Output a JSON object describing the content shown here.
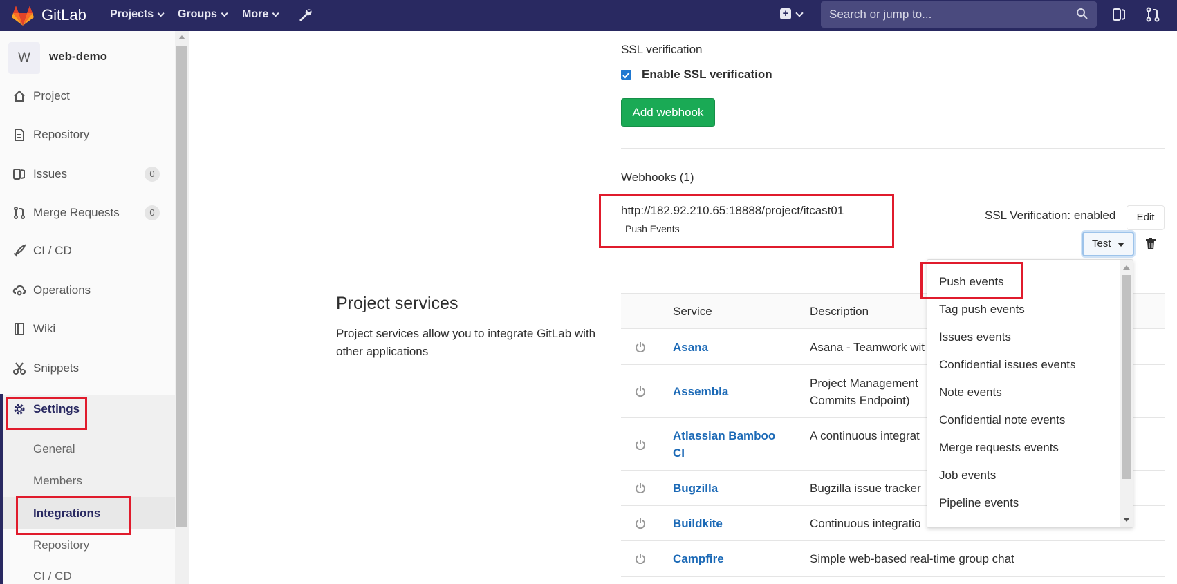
{
  "topnav": {
    "brand": "GitLab",
    "links": [
      "Projects",
      "Groups",
      "More"
    ],
    "search_placeholder": "Search or jump to..."
  },
  "sidebar": {
    "project_avatar": "W",
    "project_name": "web-demo",
    "items": [
      {
        "label": "Project",
        "icon": "home-icon"
      },
      {
        "label": "Repository",
        "icon": "file-icon"
      },
      {
        "label": "Issues",
        "icon": "issues-icon",
        "count": "0"
      },
      {
        "label": "Merge Requests",
        "icon": "merge-request-icon",
        "count": "0"
      },
      {
        "label": "CI / CD",
        "icon": "rocket-icon"
      },
      {
        "label": "Operations",
        "icon": "cloud-gear-icon"
      },
      {
        "label": "Wiki",
        "icon": "book-icon"
      },
      {
        "label": "Snippets",
        "icon": "scissors-icon"
      },
      {
        "label": "Settings",
        "icon": "gear-icon"
      }
    ],
    "settings_sub": [
      "General",
      "Members",
      "Integrations",
      "Repository",
      "CI / CD"
    ]
  },
  "ssl": {
    "heading": "SSL verification",
    "checkbox_label": "Enable SSL verification",
    "checked": true
  },
  "add_webhook_label": "Add webhook",
  "webhooks": {
    "heading": "Webhooks (1)",
    "url": "http://182.92.210.65:18888/project/itcast01",
    "badge": "Push Events",
    "ssl_status": "SSL Verification: enabled",
    "edit_label": "Edit",
    "test_label": "Test"
  },
  "project_services": {
    "title": "Project services",
    "description": "Project services allow you to integrate GitLab with other applications",
    "headers": [
      "Service",
      "Description"
    ],
    "rows": [
      {
        "service": "Asana",
        "description": "Asana - Teamwork wit"
      },
      {
        "service": "Assembla",
        "description": "Project Management Commits Endpoint)"
      },
      {
        "service": "Atlassian Bamboo CI",
        "description": "A continuous integrat"
      },
      {
        "service": "Bugzilla",
        "description": "Bugzilla issue tracker"
      },
      {
        "service": "Buildkite",
        "description": "Continuous integratio"
      },
      {
        "service": "Campfire",
        "description": "Simple web-based real-time group chat"
      }
    ]
  },
  "test_dropdown": {
    "items": [
      "Push events",
      "Tag push events",
      "Issues events",
      "Confidential issues events",
      "Note events",
      "Confidential note events",
      "Merge requests events",
      "Job events",
      "Pipeline events"
    ]
  },
  "colors": {
    "nav_bg": "#292961",
    "green": "#1aaa55",
    "link": "#1b69b6",
    "highlight_red": "#e01b2c"
  }
}
